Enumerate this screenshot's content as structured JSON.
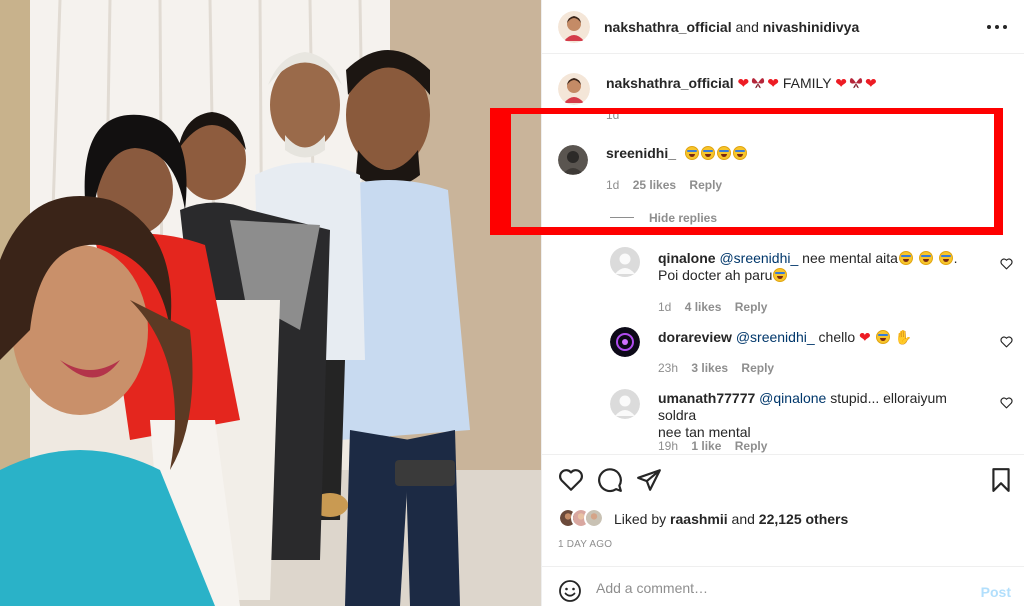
{
  "post": {
    "author": "nakshathra_official",
    "joiner": "and",
    "collaborator": "nivashinidivya",
    "more_icon": "more-horizontal-icon"
  },
  "caption": {
    "username": "nakshathra_official",
    "text": "FAMILY",
    "time": "1d"
  },
  "comment": {
    "username": "sreenidhi_",
    "emoji_count": 4,
    "time": "1d",
    "likes": "25 likes",
    "reply_label": "Reply",
    "hide_replies": "Hide replies"
  },
  "replies": [
    {
      "username": "qinalone",
      "mention": "@sreenidhi_",
      "text": "nee mental aita",
      "text2": "Poi docter ah paru",
      "time": "1d",
      "likes": "4 likes",
      "reply_label": "Reply"
    },
    {
      "username": "dorareview",
      "mention": "@sreenidhi_",
      "text": "chello",
      "time": "23h",
      "likes": "3 likes",
      "reply_label": "Reply"
    },
    {
      "username": "umanath77777",
      "mention": "@qinalone",
      "text": "stupid... elloraiyum soldra",
      "text2": "nee tan mental",
      "time": "19h",
      "likes": "1 like",
      "reply_label": "Reply"
    }
  ],
  "actions": {
    "liked_by_prefix": "Liked by",
    "liked_by_user": "raashmii",
    "and": "and",
    "others": "22,125 others",
    "date": "1 DAY AGO"
  },
  "add_comment": {
    "placeholder": "Add a comment…",
    "post_label": "Post"
  },
  "colors": {
    "highlight": "#fe0000",
    "link": "#00376b",
    "muted": "#8e8e8e",
    "post_disabled": "#b2dffc",
    "heart": "#ed1c24"
  }
}
